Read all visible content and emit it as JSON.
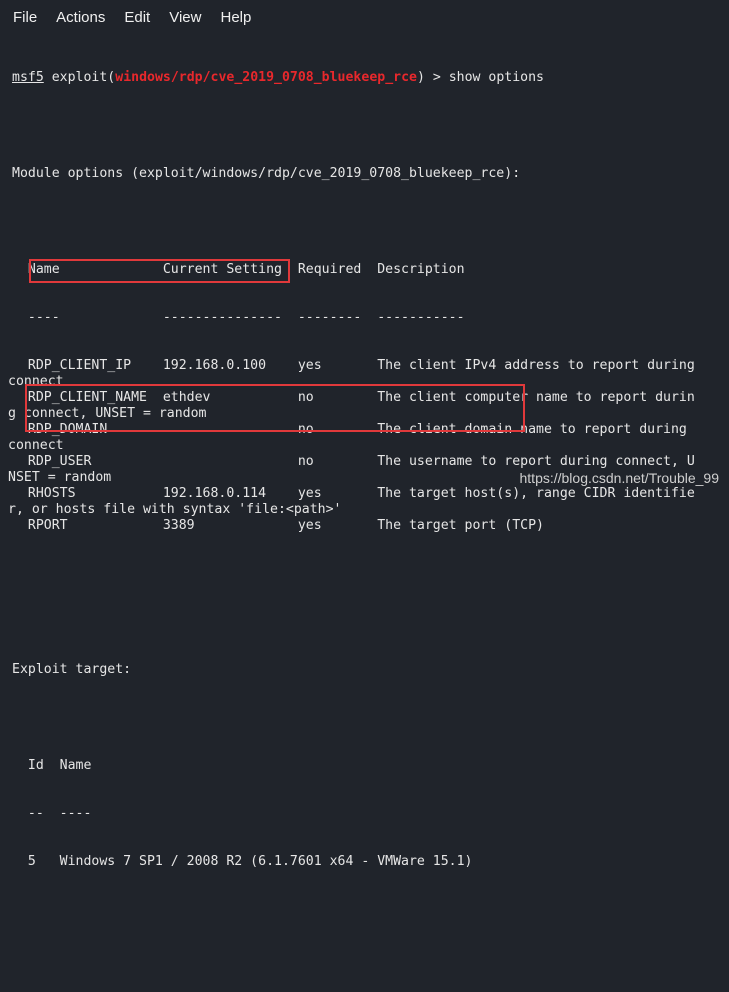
{
  "menu": [
    "File",
    "Actions",
    "Edit",
    "View",
    "Help"
  ],
  "prompt": {
    "name": "msf5",
    "exploit_word": "exploit(",
    "module": "windows/rdp/cve_2019_0708_bluekeep_rce",
    "close": ") >"
  },
  "command": " show options",
  "module_options_header": "Module options (exploit/windows/rdp/cve_2019_0708_bluekeep_rce):",
  "options_columns": [
    "Name",
    "Current Setting",
    "Required",
    "Description"
  ],
  "options_rows": [
    {
      "name": "RDP_CLIENT_IP",
      "setting": "192.168.0.100",
      "required": "yes",
      "desc": "The client IPv4 address to report during",
      "wrap": "connect"
    },
    {
      "name": "RDP_CLIENT_NAME",
      "setting": "ethdev",
      "required": "no",
      "desc": "The client computer name to report durin",
      "wrap": "g connect, UNSET = random"
    },
    {
      "name": "RDP_DOMAIN",
      "setting": "",
      "required": "no",
      "desc": "The client domain name to report during",
      "wrap": "connect"
    },
    {
      "name": "RDP_USER",
      "setting": "",
      "required": "no",
      "desc": "The username to report during connect, U",
      "wrap": "NSET = random"
    },
    {
      "name": "RHOSTS",
      "setting": "192.168.0.114",
      "required": "yes",
      "desc": "The target host(s), range CIDR identifie",
      "wrap": "r, or hosts file with syntax 'file:<path>'"
    },
    {
      "name": "RPORT",
      "setting": "3389",
      "required": "yes",
      "desc": "The target port (TCP)",
      "wrap": ""
    }
  ],
  "exploit_target_header": "Exploit target:",
  "target_columns": [
    "Id",
    "Name"
  ],
  "target_rows": [
    {
      "id": "5",
      "name": "Windows 7 SP1 / 2008 R2 (6.1.7601 x64 - VMWare 15.1)"
    }
  ],
  "watermark": "https://blog.csdn.net/Trouble_99",
  "colors": {
    "background": "#20242b",
    "module_red": "#e8282c",
    "highlight": "#e0393b"
  }
}
